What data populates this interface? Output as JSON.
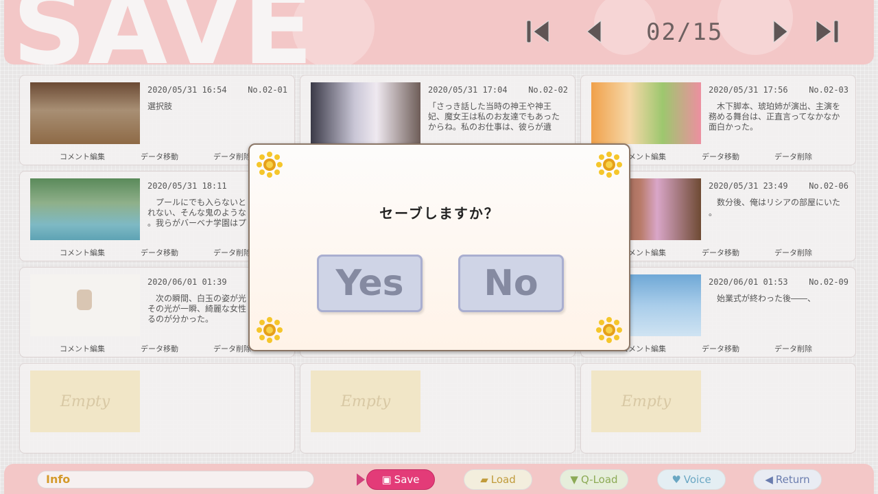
{
  "header": {
    "title": "SAVE",
    "page_indicator": "02/15"
  },
  "slots": [
    {
      "date": "2020/05/31 16:54",
      "no": "No.02-01",
      "text": "選択肢"
    },
    {
      "date": "2020/05/31 17:04",
      "no": "No.02-02",
      "text": "「さっき話した当時の神王や神王妃、魔女王は私のお友達でもあったからね。私のお仕事は、彼らが遺"
    },
    {
      "date": "2020/05/31 17:56",
      "no": "No.02-03",
      "text": "　木下脚本、琥珀姉が演出、主演を務める舞台は、正直言ってなかなか面白かった。"
    },
    {
      "date": "2020/05/31 18:11",
      "no": "N",
      "text": "　プールにでも入らないと\nれない、そんな鬼のような\n。我らがバーベナ学園はプ"
    },
    {
      "date": "",
      "no": "",
      "text": ""
    },
    {
      "date": "2020/05/31 23:49",
      "no": "No.02-06",
      "text": "　数分後、俺はリシアの部屋にいた\n。"
    },
    {
      "date": "2020/06/01 01:39",
      "no": "N",
      "text": "　次の瞬間、白玉の姿が光\nその光が一瞬、綺麗な女性\nるのが分かった。"
    },
    {
      "date": "",
      "no": "",
      "text": ""
    },
    {
      "date": "2020/06/01 01:53",
      "no": "No.02-09",
      "text": "　始業式が終わった後――、"
    },
    {
      "empty_label": "Empty"
    },
    {
      "empty_label": "Empty"
    },
    {
      "empty_label": "Empty"
    }
  ],
  "slot_actions": {
    "comment": "コメント編集",
    "move": "データ移動",
    "delete": "データ削除",
    "delete_partial": "データ削除"
  },
  "modal": {
    "question": "セーブしますか？",
    "yes_label": "Yes",
    "no_label": "No"
  },
  "footer": {
    "info_label": "Info",
    "save_label": "Save",
    "load_label": "Load",
    "qload_label": "Q-Load",
    "voice_label": "Voice",
    "return_label": "Return"
  }
}
